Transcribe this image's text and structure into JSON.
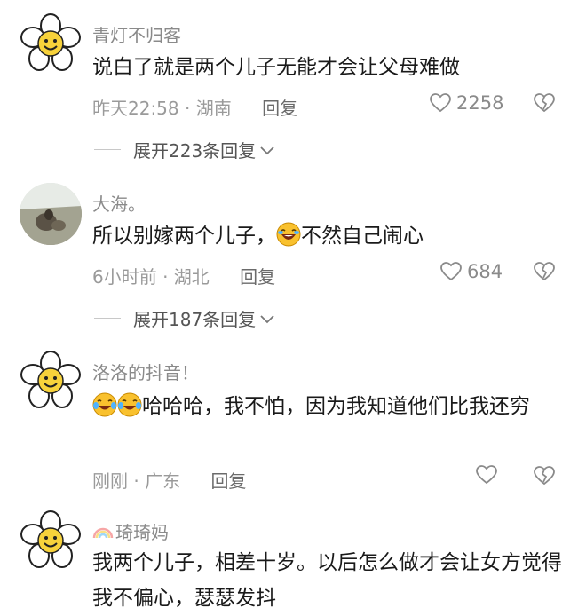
{
  "comments": [
    {
      "username": "青灯不归客",
      "text": "说白了就是两个儿子无能才会让父母难做",
      "time": "昨天22:58 · 湖南",
      "reply": "回复",
      "likes": "2258",
      "expand": "展开223条回复"
    },
    {
      "username": "大海。",
      "text_before": "所以别嫁两个儿子，",
      "text_after": "不然自己闹心",
      "time": "6小时前 · 湖北",
      "reply": "回复",
      "likes": "684",
      "expand": "展开187条回复"
    },
    {
      "username": "洛洛的抖音！",
      "text": "哈哈哈，我不怕，因为我知道他们比我还穷",
      "time": "刚刚 · 广东",
      "reply": "回复",
      "likes": ""
    },
    {
      "username": "琦琦妈",
      "text": "我两个儿子，相差十岁。以后怎么做才会让女方觉得我不偏心，瑟瑟发抖"
    }
  ],
  "icons": {
    "like": "heart-outline-icon",
    "dislike": "broken-heart-icon",
    "expand": "chevron-down-icon",
    "emoji_laugh": "laughing-emoji-icon",
    "emoji_tears": "tears-of-joy-emoji-icon",
    "rainbow": "rainbow-icon"
  },
  "colors": {
    "meta": "#9a9a9a",
    "text": "#1a1a1a",
    "username": "#8a8a8a"
  }
}
